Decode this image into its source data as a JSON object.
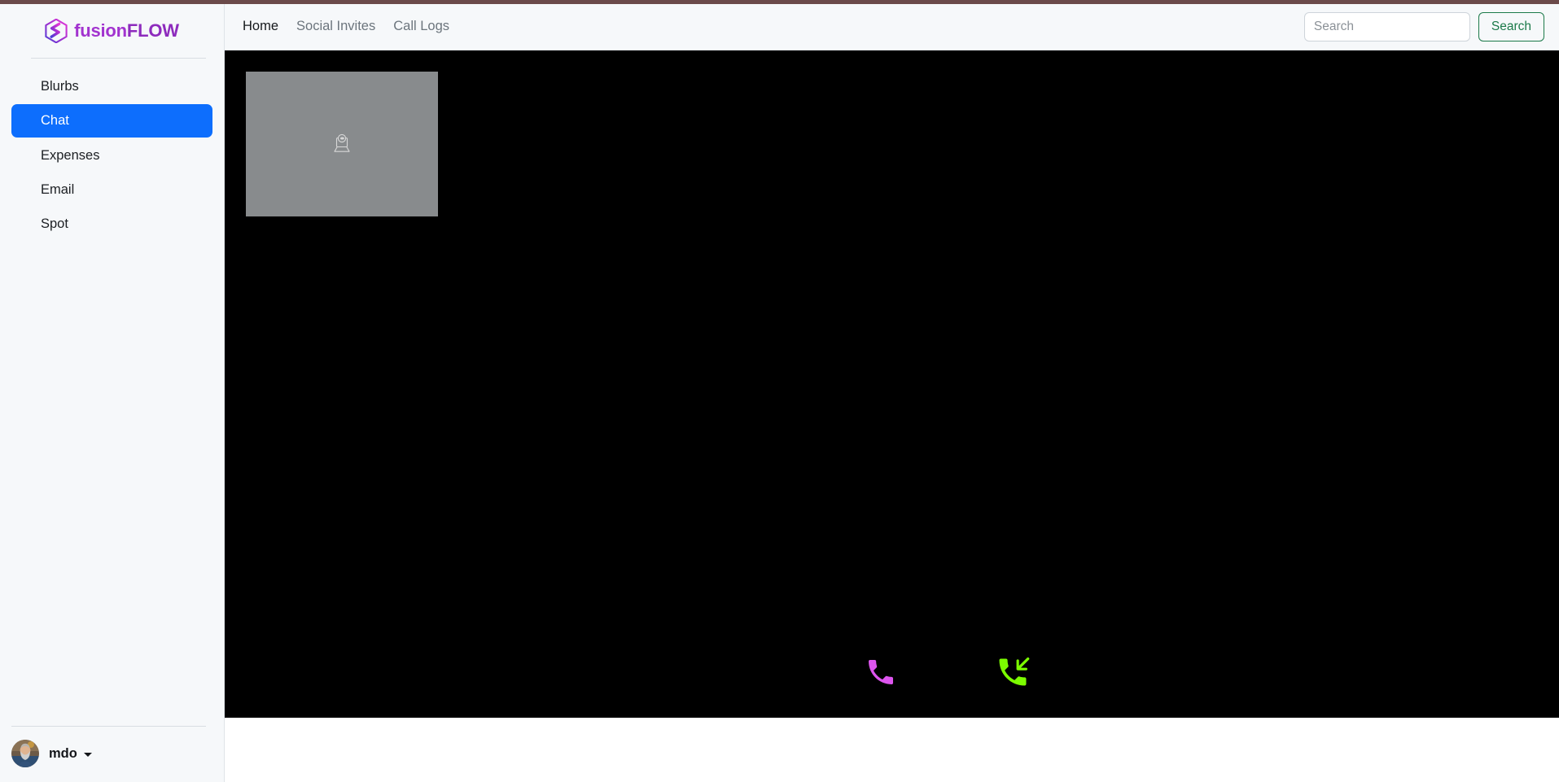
{
  "theme": {
    "top_strip_color": "#6b4a4a",
    "sidebar_bg": "#f6f8fa",
    "active_nav_color": "#0d6efd",
    "stage_bg": "#000000",
    "video_placeholder_color": "#888b8d",
    "hangup_icon_color": "#dd55ee",
    "incoming_icon_color": "#7cfc00",
    "search_button_color": "#1c7a4a",
    "brand_color": "#8d2bbd"
  },
  "brand": {
    "icon": "cube-logo-icon",
    "text_part1": "fusion",
    "text_part2": "FLOW",
    "full_text": "fusionFLOW"
  },
  "sidebar": {
    "items": [
      {
        "label": "Blurbs",
        "name": "blurbs",
        "active": false
      },
      {
        "label": "Chat",
        "name": "chat",
        "active": true
      },
      {
        "label": "Expenses",
        "name": "expenses",
        "active": false
      },
      {
        "label": "Email",
        "name": "email",
        "active": false
      },
      {
        "label": "Spot",
        "name": "spot",
        "active": false
      }
    ],
    "user": {
      "name": "mdo",
      "avatar": "user-avatar-photo",
      "caret": "chevron-down-icon"
    }
  },
  "topnav": {
    "links": [
      {
        "label": "Home",
        "name": "home",
        "active": true
      },
      {
        "label": "Social Invites",
        "name": "social-invites",
        "active": false
      },
      {
        "label": "Call Logs",
        "name": "call-logs",
        "active": false
      }
    ]
  },
  "search": {
    "value": "",
    "placeholder": "Search",
    "button_label": "Search"
  },
  "call": {
    "local_video": {
      "icon": "webcam-icon",
      "state": "camera-off-placeholder"
    },
    "remote_video": {
      "state": "no-signal"
    },
    "controls": [
      {
        "name": "hangup-call-button",
        "icon": "phone-icon",
        "color": "#dd55ee"
      },
      {
        "name": "incoming-call-button",
        "icon": "phone-incoming-icon",
        "color": "#7cfc00"
      }
    ]
  }
}
